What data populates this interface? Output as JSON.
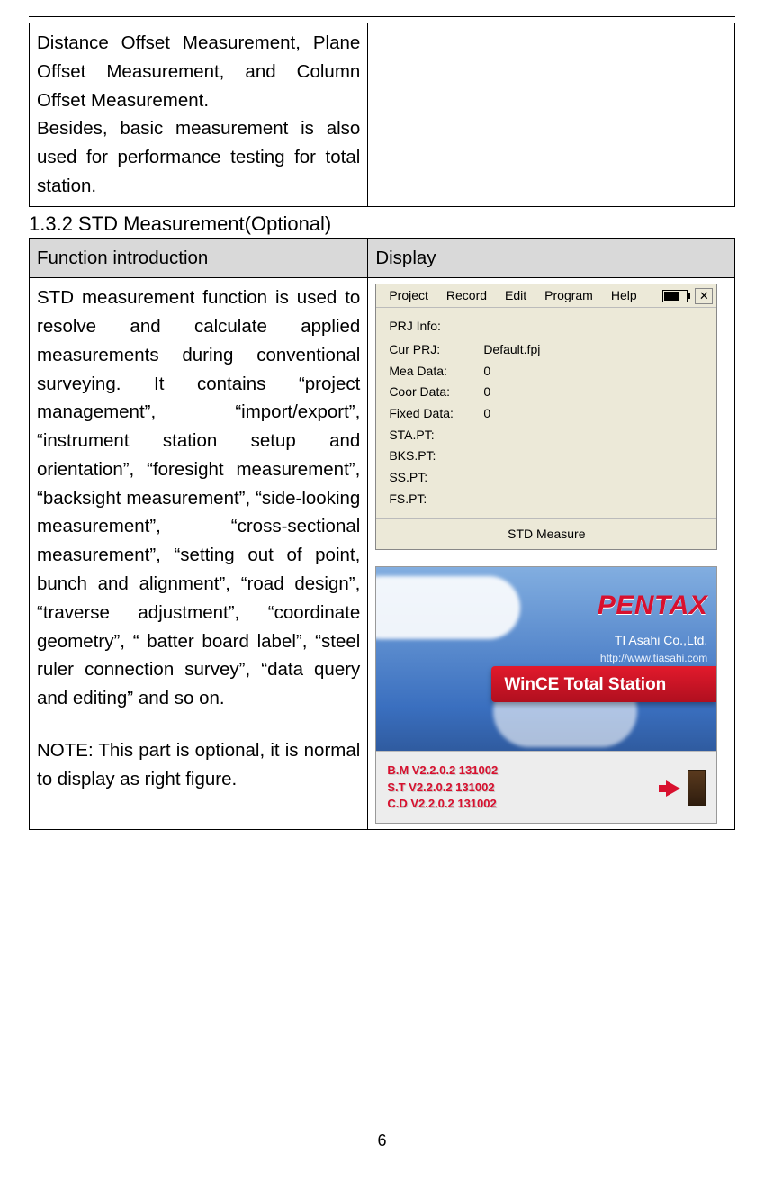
{
  "topcell_text_1": "Distance Offset Measurement, Plane Offset Measurement, and Column Offset Measurement.",
  "topcell_text_2": "Besides, basic measurement is also used for performance testing for total station.",
  "section_heading": "1.3.2 STD Measurement(Optional)",
  "table_header_left": "Function introduction",
  "table_header_right": "Display",
  "func_intro": "STD measurement function is used to resolve and calculate applied measurements during conventional surveying. It contains “project management”, “import/export”, “instrument station setup and orientation”, “foresight measurement”, “backsight measurement”, “side-looking measurement”, “cross-sectional measurement”, “setting out of point, bunch and alignment”, “road design”, “traverse adjustment”, “coordinate geometry”, “ batter board label”, “steel ruler connection survey”, “data query and editing” and so on.",
  "func_note": "NOTE: This part is optional, it is normal to display as right figure.",
  "app": {
    "menu": {
      "project": "Project",
      "record": "Record",
      "edit": "Edit",
      "program": "Program",
      "help": "Help"
    },
    "prj_info_label": "PRJ Info:",
    "rows": {
      "cur_prj": {
        "k": "Cur PRJ:",
        "v": "Default.fpj"
      },
      "mea_data": {
        "k": "Mea Data:",
        "v": "0"
      },
      "coor_data": {
        "k": "Coor Data:",
        "v": "0"
      },
      "fixed_data": {
        "k": "Fixed Data:",
        "v": "0"
      },
      "sta_pt": {
        "k": "STA.PT:",
        "v": ""
      },
      "bks_pt": {
        "k": "BKS.PT:",
        "v": ""
      },
      "ss_pt": {
        "k": "SS.PT:",
        "v": ""
      },
      "fs_pt": {
        "k": "FS.PT:",
        "v": ""
      }
    },
    "status": "STD Measure"
  },
  "splash": {
    "brand": "PENTAX",
    "company": "TI Asahi Co.,Ltd.",
    "url": "http://www.tiasahi.com",
    "banner": "WinCE Total Station",
    "ver1": "B.M V2.2.0.2 131002",
    "ver2": "S.T V2.2.0.2 131002",
    "ver3": "C.D V2.2.0.2 131002"
  },
  "page_number": "6"
}
